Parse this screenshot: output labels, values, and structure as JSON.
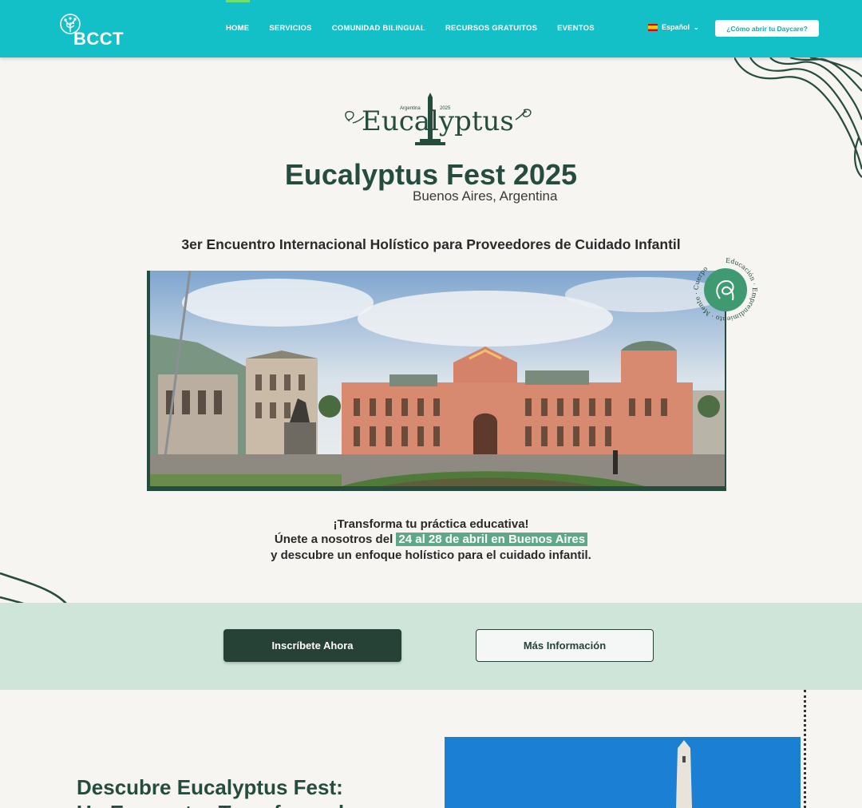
{
  "header": {
    "logo_text": "BCCT",
    "nav": [
      "HOME",
      "SERVICIOS",
      "COMUNIDAD BILINGUAL",
      "RECURSOS GRATUITOS",
      "EVENTOS"
    ],
    "language": "Español",
    "cta": "¿Cómo abrir tu Daycare?"
  },
  "hero": {
    "logo_word": "Eucalyptus",
    "logo_small_left": "Argentina",
    "logo_small_right": "2025",
    "title": "Eucalyptus Fest 2025",
    "subtitle": "Buenos Aires, Argentina",
    "tagline": "3er Encuentro Internacional Holístico para Proveedores de Cuidado Infantil",
    "badge_words": "Educación · Emprendimiento · Mente · Cuerpo"
  },
  "promo": {
    "line1": "¡Transforma tu práctica educativa!",
    "line2_prefix": "Únete a nosotros del",
    "line2_highlight": "24 al 28 de abril en Buenos Aires",
    "line3": "y descubre un enfoque holístico para el cuidado infantil."
  },
  "cta_band": {
    "primary": "Inscríbete Ahora",
    "secondary": "Más Información"
  },
  "discover": {
    "title_line1": "Descubre Eucalyptus Fest:",
    "title_line2": "Un Encuentro Transformador"
  },
  "colors": {
    "header_bg": "#14c0c8",
    "brand_green": "#264c3f",
    "highlight": "#5da88a",
    "band_bg": "#cfe5da"
  }
}
